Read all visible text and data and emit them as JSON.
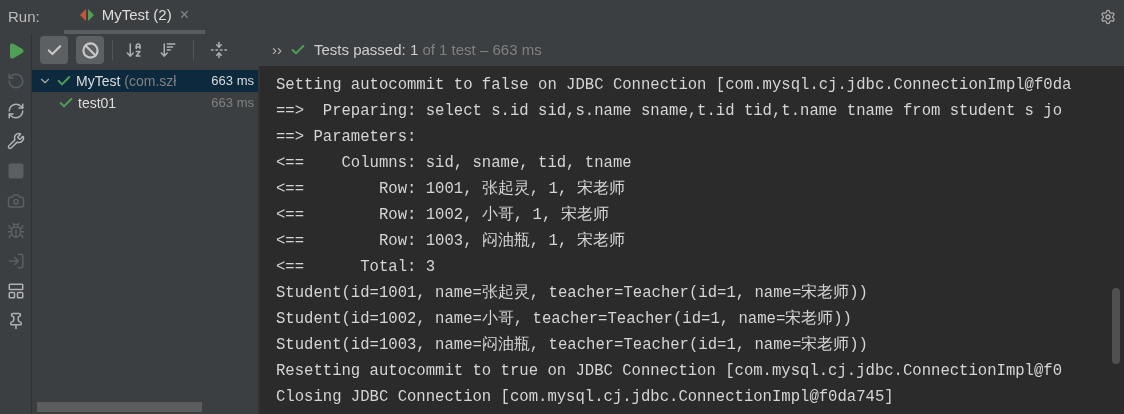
{
  "run_bar": {
    "label": "Run:",
    "tab": {
      "title": "MyTest (2)",
      "close": "×"
    }
  },
  "toolbar": {
    "toggles": [
      {
        "kind": "passed",
        "selected": true
      },
      {
        "kind": "ignored",
        "selected": true
      }
    ],
    "more": "››",
    "status": {
      "strong": "Tests passed: 1",
      "rest": " of 1 test – 663 ms"
    }
  },
  "side_tools": [
    {
      "kind": "run",
      "disabled": false
    },
    {
      "kind": "rerun",
      "disabled": true
    },
    {
      "kind": "toggle",
      "disabled": false
    },
    {
      "kind": "wrench",
      "disabled": false
    },
    {
      "kind": "stop",
      "disabled": true
    },
    {
      "kind": "camera",
      "disabled": true
    },
    {
      "kind": "bug",
      "disabled": true
    },
    {
      "kind": "exit",
      "disabled": true
    },
    {
      "kind": "layout",
      "disabled": false
    },
    {
      "kind": "pin",
      "disabled": false
    }
  ],
  "tree": [
    {
      "name": "MyTest",
      "detail": "(com.szł",
      "time": "663 ms",
      "selected": true,
      "expanded": true,
      "children": [
        {
          "name": "test01",
          "time": "663 ms",
          "selected": false
        }
      ]
    }
  ],
  "console": [
    "Setting autocommit to false on JDBC Connection [com.mysql.cj.jdbc.ConnectionImpl@f0da",
    "==>  Preparing: select s.id sid,s.name sname,t.id tid,t.name tname from student s jo",
    "==> Parameters: ",
    "<==    Columns: sid, sname, tid, tname",
    "<==        Row: 1001, 张起灵, 1, 宋老师",
    "<==        Row: 1002, 小哥, 1, 宋老师",
    "<==        Row: 1003, 闷油瓶, 1, 宋老师",
    "<==      Total: 3",
    "Student(id=1001, name=张起灵, teacher=Teacher(id=1, name=宋老师))",
    "Student(id=1002, name=小哥, teacher=Teacher(id=1, name=宋老师))",
    "Student(id=1003, name=闷油瓶, teacher=Teacher(id=1, name=宋老师))",
    "Resetting autocommit to true on JDBC Connection [com.mysql.cj.jdbc.ConnectionImpl@f0",
    "Closing JDBC Connection [com.mysql.cj.jdbc.ConnectionImpl@f0da745]"
  ]
}
